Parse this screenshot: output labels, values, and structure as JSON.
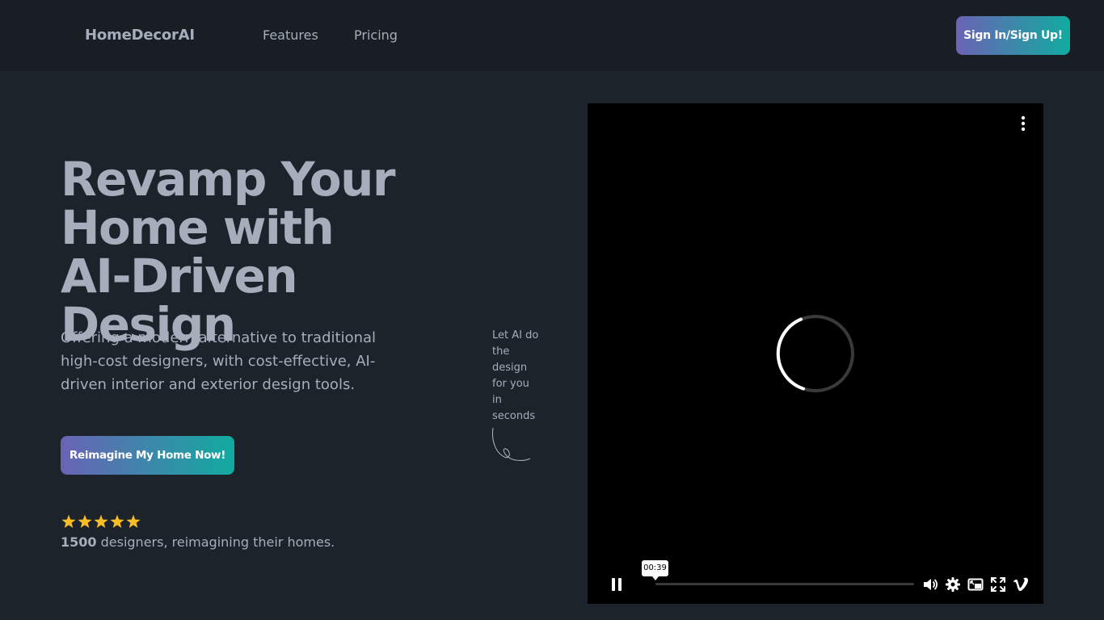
{
  "navbar": {
    "brand": "HomeDecorAI",
    "links": [
      "Features",
      "Pricing"
    ],
    "signin_label": "Sign In/Sign Up!"
  },
  "hero": {
    "title": "Revamp Your Home with AI-Driven Design",
    "subtitle": "Offering a modern alternative to traditional high-cost designers, with cost-effective, AI-driven interior and exterior design tools.",
    "cta_label": "Reimagine My Home Now!",
    "stars": 5,
    "rating_count": "1500",
    "rating_text": " designers, reimagining their homes."
  },
  "side_note": "Let AI do the design for you in seconds",
  "video": {
    "time_tooltip": "00:39",
    "icons": [
      "more-vertical-icon",
      "loading-spinner-icon",
      "pause-icon",
      "volume-icon",
      "settings-gear-icon",
      "picture-in-picture-icon",
      "fullscreen-icon",
      "vimeo-logo-icon"
    ]
  },
  "colors": {
    "background": "#1d232a",
    "navbar": "#191e24",
    "text": "#a6adbb",
    "gradient_start": "#6a63b5",
    "gradient_end": "#11ab9f",
    "star": "#fbbd23"
  }
}
